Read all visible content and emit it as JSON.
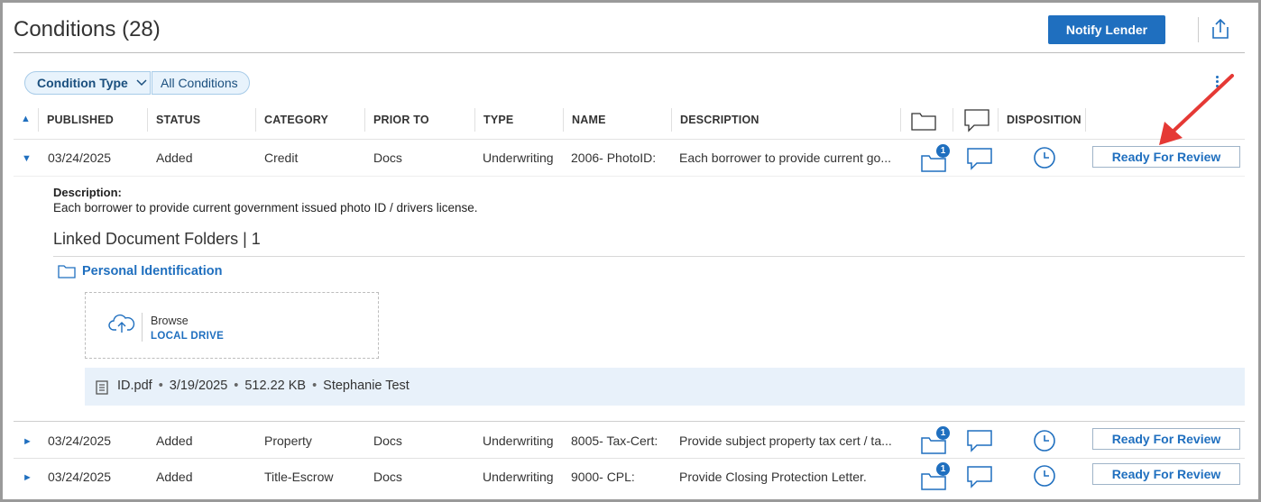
{
  "header": {
    "title": "Conditions (28)",
    "notify_label": "Notify Lender"
  },
  "filters": {
    "condition_type_label": "Condition Type",
    "all_conditions_label": "All Conditions"
  },
  "table": {
    "columns": [
      "PUBLISHED",
      "STATUS",
      "CATEGORY",
      "PRIOR TO",
      "TYPE",
      "NAME",
      "DESCRIPTION",
      "DISPOSITION"
    ],
    "rows": [
      {
        "published": "03/24/2025",
        "status": "Added",
        "category": "Credit",
        "prior_to": "Docs",
        "type": "Underwriting",
        "name": "2006- PhotoID:",
        "description": "Each borrower to provide current go...",
        "folder_count": "1",
        "action_label": "Ready For Review",
        "expanded": true
      },
      {
        "published": "03/24/2025",
        "status": "Added",
        "category": "Property",
        "prior_to": "Docs",
        "type": "Underwriting",
        "name": "8005- Tax-Cert:",
        "description": "Provide subject property tax cert / ta...",
        "folder_count": "1",
        "action_label": "Ready For Review",
        "expanded": false
      },
      {
        "published": "03/24/2025",
        "status": "Added",
        "category": "Title-Escrow",
        "prior_to": "Docs",
        "type": "Underwriting",
        "name": "9000- CPL:",
        "description": "Provide Closing Protection Letter.",
        "folder_count": "1",
        "action_label": "Ready For Review",
        "expanded": false
      }
    ]
  },
  "detail": {
    "description_label": "Description:",
    "description_text": "Each borrower to provide current government issued photo ID / drivers license.",
    "linked_folders_title": "Linked Document Folders | 1",
    "folder_name": "Personal Identification",
    "browse_label": "Browse",
    "local_drive_label": "LOCAL DRIVE",
    "file": {
      "name": "ID.pdf",
      "date": "3/19/2025",
      "size": "512.22 KB",
      "owner": "Stephanie Test",
      "separator": "•"
    }
  },
  "icons": {
    "share": "share-icon",
    "folder": "folder-icon",
    "comment": "comment-icon",
    "clock": "clock-icon",
    "cloud_upload": "cloud-upload-icon",
    "document": "document-icon",
    "arrow_annotation": "red-arrow"
  },
  "colors": {
    "accent": "#1f6fbf",
    "annotation_arrow": "#e53935",
    "file_row_bg": "#e8f1fa"
  }
}
